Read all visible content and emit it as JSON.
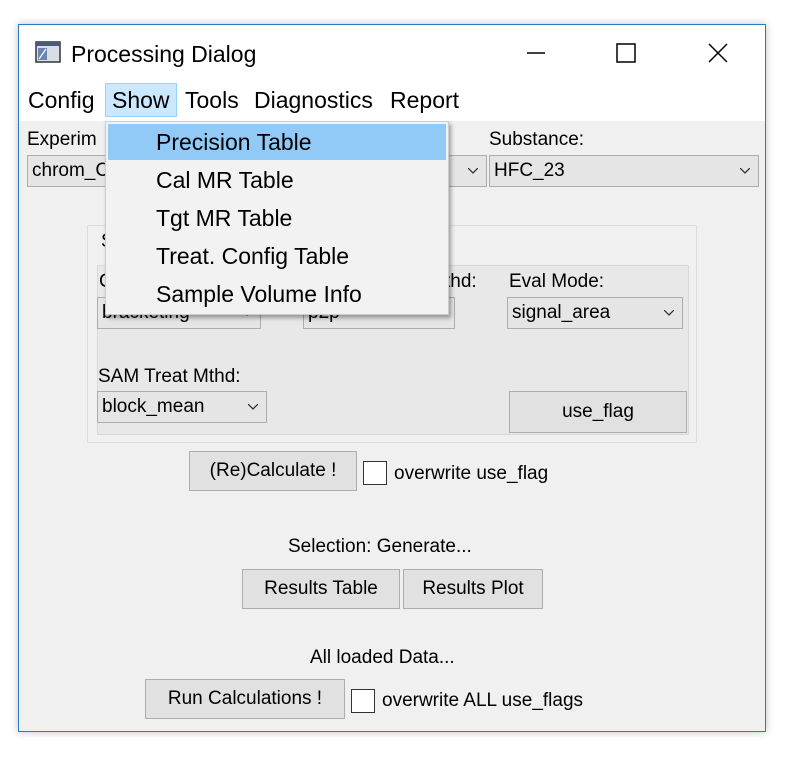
{
  "window": {
    "title": "Processing Dialog"
  },
  "menu": {
    "items": [
      "Config",
      "Show",
      "Tools",
      "Diagnostics",
      "Report"
    ],
    "open_menu": "Show",
    "dropdown": [
      "Precision Table",
      "Cal MR Table",
      "Tgt MR Table",
      "Treat. Config Table",
      "Sample Volume Info"
    ],
    "highlighted": "Precision Table"
  },
  "experiment": {
    "label": "Experim",
    "value": "chrom_C"
  },
  "substance": {
    "label": "Substance:",
    "value": "HFC_23"
  },
  "group": {
    "title": "S",
    "cal_label": "C",
    "cal_value": "bracketing",
    "mthd_label": "thd:",
    "mthd_value": "p2p",
    "eval_label": "Eval Mode:",
    "eval_value": "signal_area",
    "sam_label": "SAM Treat Mthd:",
    "sam_value": "block_mean",
    "use_flag_button": "use_flag"
  },
  "recalc": {
    "button": "(Re)Calculate !",
    "checkbox_label": "overwrite use_flag"
  },
  "selection": {
    "label": "Selection: Generate...",
    "results_table": "Results Table",
    "results_plot": "Results Plot"
  },
  "all_data": {
    "label": "All loaded Data...",
    "run_button": "Run Calculations !",
    "checkbox_label": "overwrite ALL use_flags"
  }
}
